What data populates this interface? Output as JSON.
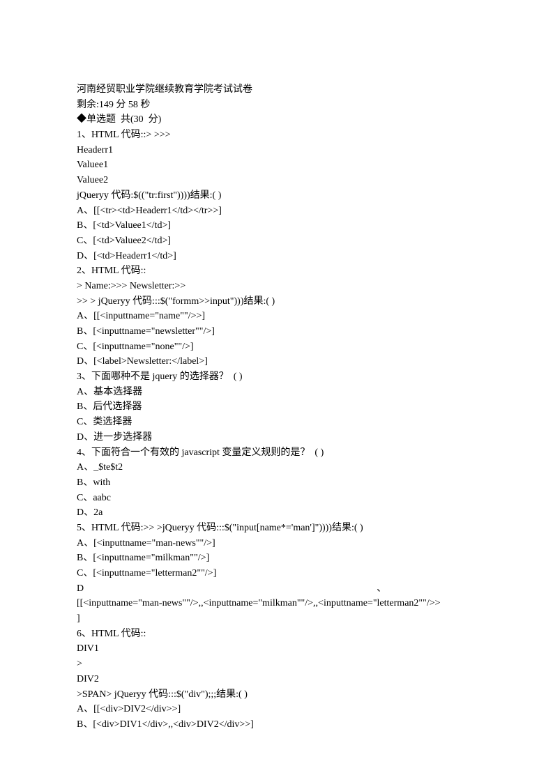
{
  "lines": [
    "河南经贸职业学院继续教育学院考试试卷",
    "剩余:149 分 58 秒",
    "◆单选题  共(30  分)",
    "1、HTML 代码::> >>>",
    "Headerr1",
    "Valuee1",
    "Valuee2",
    "jQueryy 代码:$((\"tr:first\"))))结果:( )",
    "A、[[<tr><td>Headerr1</td></tr>>]",
    "B、[<td>Valuee1</td>]",
    "C、[<td>Valuee2</td>]",
    "D、[<td>Headerr1</td>]",
    "2、HTML 代码::",
    "> Name:>>> Newsletter:>>",
    ">> > jQueryy 代码:::$(\"formm>>input\")))结果:( )",
    "A、[[<inputtname=\"name\"\"/>>]",
    "B、[<inputtname=\"newsletter\"\"/>]",
    "C、[<inputtname=\"none\"\"/>]",
    "D、[<label>Newsletter:</label>]",
    "3、下面哪种不是 jquery 的选择器？  ( )",
    "A、基本选择器",
    "B、后代选择器",
    "C、类选择器",
    "D、进一步选择器",
    "4、下面符合一个有效的 javascript 变量定义规则的是？  ( )",
    "A、_$te$t2",
    "B、with",
    "C、aabc",
    "D、2a",
    "5、HTML 代码:>> >jQueryy 代码:::$(\"input[name*='man']\"))))结果:( )",
    "A、[<inputtname=\"man-news\"\"/>]",
    "B、[<inputtname=\"milkman\"\"/>]",
    "C、[<inputtname=\"letterman2\"\"/>]",
    "D                                                                                                                        、",
    "[[<inputtname=\"man-news\"\"/>,,<inputtname=\"milkman\"\"/>,,<inputtname=\"letterman2\"\"/>>",
    "]",
    "6、HTML 代码::",
    "DIV1",
    ">",
    "DIV2",
    ">SPAN> jQueryy 代码:::$(\"div\");;;结果:( )",
    "A、[[<div>DIV2</div>>]",
    "B、[<div>DIV1</div>,,<div>DIV2</div>>]"
  ]
}
